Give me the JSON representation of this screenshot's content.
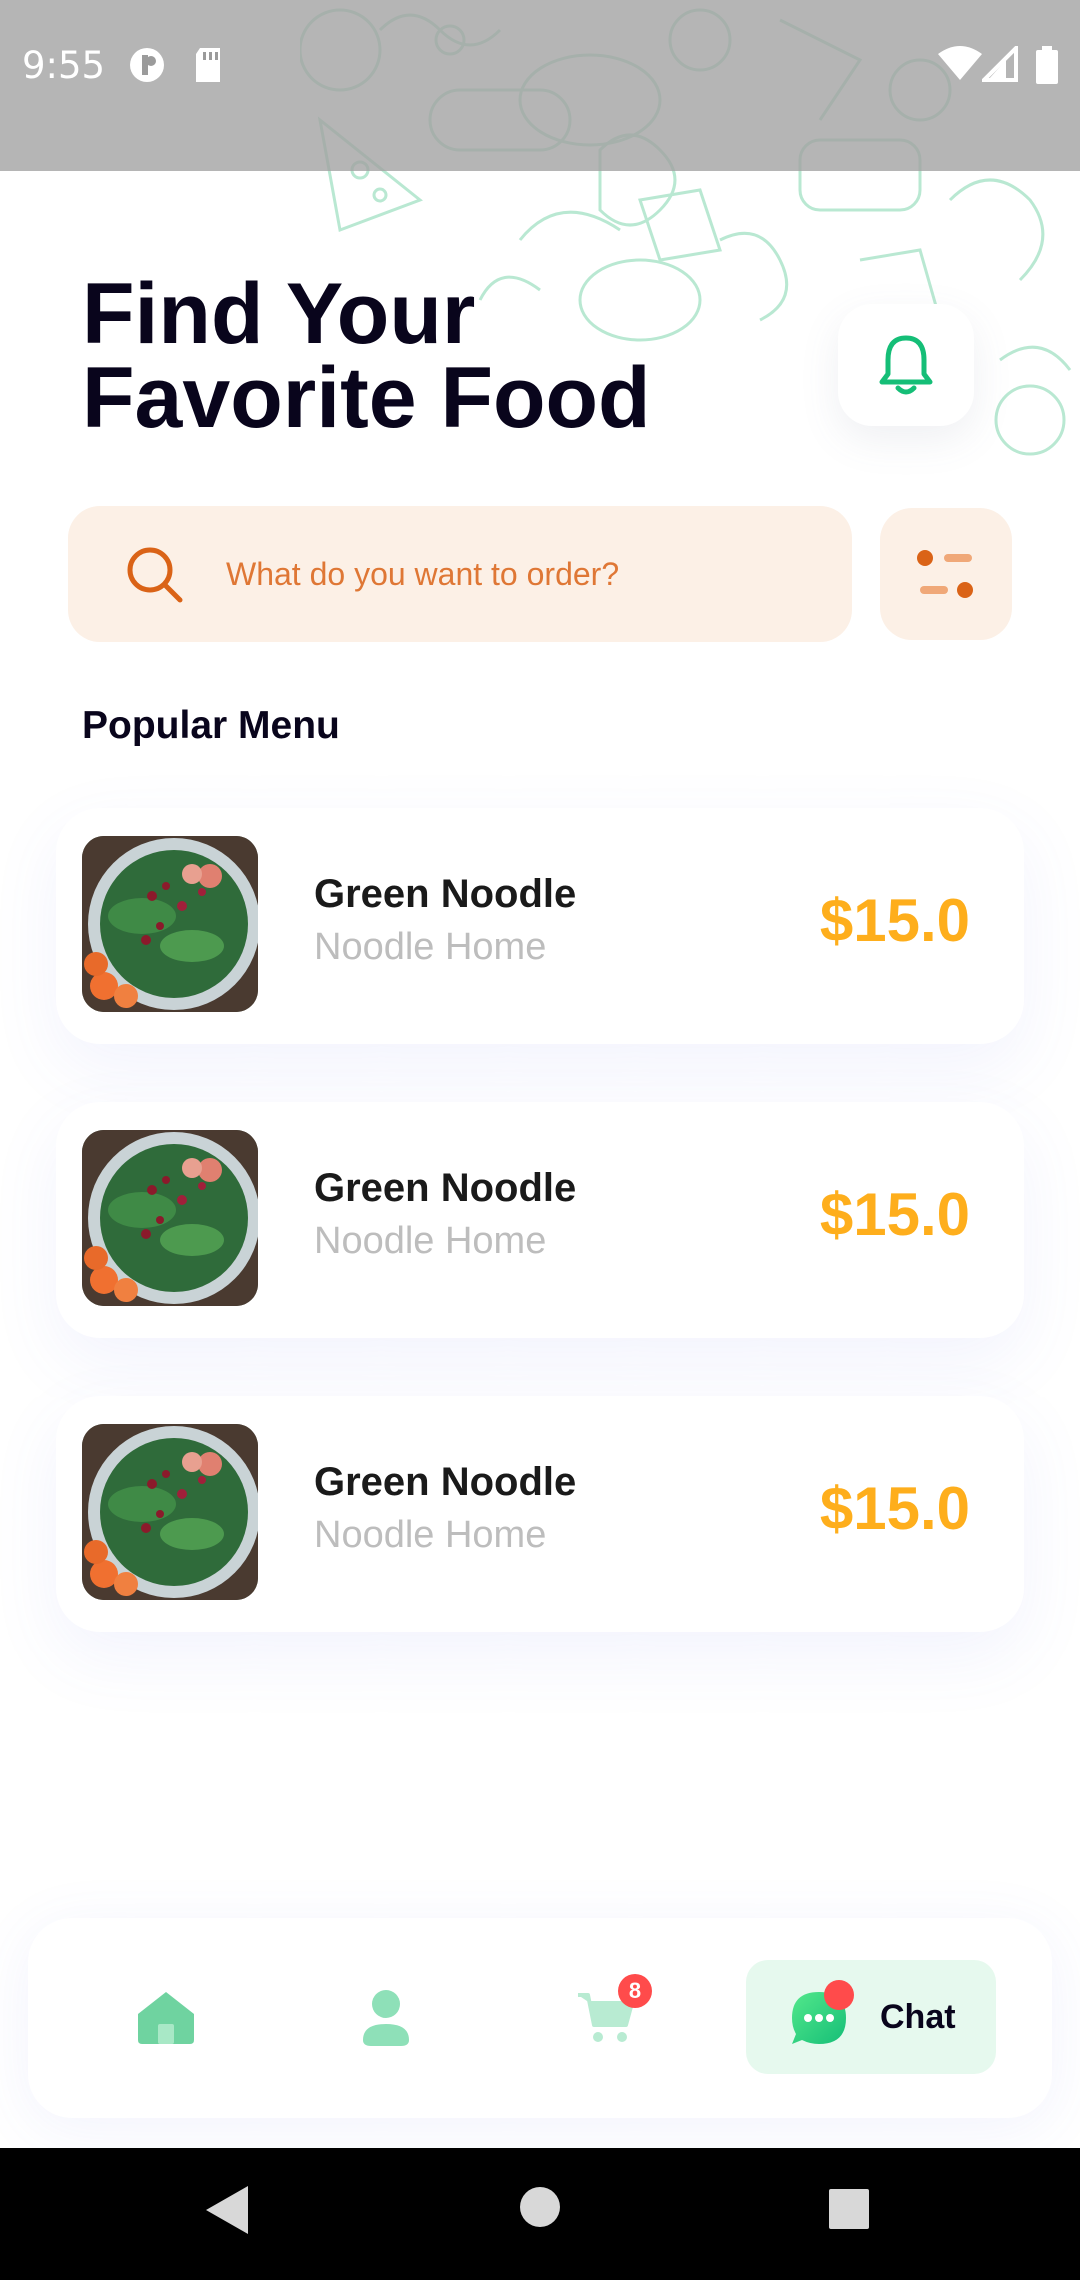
{
  "status_bar": {
    "time": "9:55"
  },
  "header": {
    "title_line1": "Find Your",
    "title_line2": "Favorite Food"
  },
  "search": {
    "placeholder": "What do you want to order?"
  },
  "section_title": "Popular Menu",
  "menu_items": [
    {
      "name": "Green Noodle",
      "restaurant": "Noodle Home",
      "price": "$15.0"
    },
    {
      "name": "Green Noodle",
      "restaurant": "Noodle Home",
      "price": "$15.0"
    },
    {
      "name": "Green Noodle",
      "restaurant": "Noodle Home",
      "price": "$15.0"
    }
  ],
  "bottom_nav": {
    "cart_badge": "8",
    "chat_label": "Chat",
    "active_tab": "chat"
  },
  "colors": {
    "accent_green": "#15be77",
    "price_orange": "#feae1c",
    "search_text": "#da6317",
    "search_bg": "#fcf0e6",
    "badge_red": "#ff4b4b"
  },
  "icons": [
    "notification-bell-icon",
    "search-icon",
    "filter-icon",
    "home-icon",
    "profile-icon",
    "cart-icon",
    "chat-icon",
    "back-icon",
    "home-circle-icon",
    "recents-icon"
  ]
}
